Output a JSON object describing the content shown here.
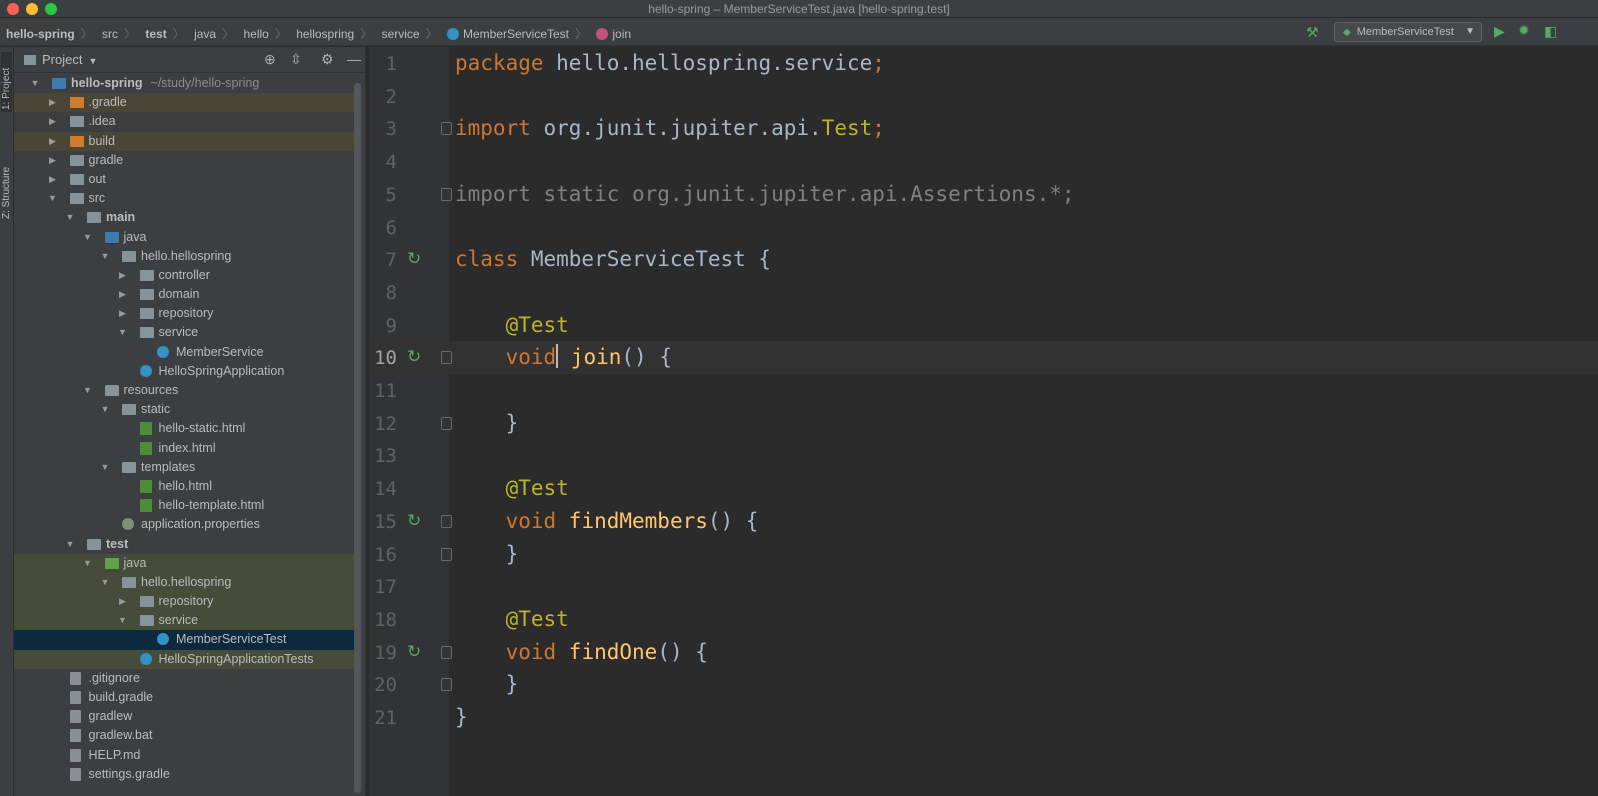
{
  "window": {
    "title": "hello-spring – MemberServiceTest.java [hello-spring.test]"
  },
  "navbar": {
    "crumbs": [
      "hello-spring",
      "src",
      "test",
      "java",
      "hello",
      "hellospring",
      "service",
      "MemberServiceTest",
      "join"
    ],
    "run_config": "MemberServiceTest"
  },
  "toolwindows": {
    "project_tab": "1: Project",
    "structure_tab": "Z: Structure"
  },
  "project_panel": {
    "title": "Project",
    "tree": [
      {
        "label": "hello-spring",
        "path": "~/study/hello-spring",
        "depth": 0,
        "expanded": true,
        "icon": "module-folder",
        "bold": true
      },
      {
        "label": ".gradle",
        "depth": 1,
        "expanded": false,
        "icon": "excluded-folder",
        "row": "excluded"
      },
      {
        "label": ".idea",
        "depth": 1,
        "expanded": false,
        "icon": "folder"
      },
      {
        "label": "build",
        "depth": 1,
        "expanded": false,
        "icon": "excluded-folder",
        "row": "excluded"
      },
      {
        "label": "gradle",
        "depth": 1,
        "expanded": false,
        "icon": "folder"
      },
      {
        "label": "out",
        "depth": 1,
        "expanded": false,
        "icon": "folder"
      },
      {
        "label": "src",
        "depth": 1,
        "expanded": true,
        "icon": "folder"
      },
      {
        "label": "main",
        "depth": 2,
        "expanded": true,
        "icon": "folder",
        "bold": true
      },
      {
        "label": "java",
        "depth": 3,
        "expanded": true,
        "icon": "source-folder"
      },
      {
        "label": "hello.hellospring",
        "depth": 4,
        "expanded": true,
        "icon": "package"
      },
      {
        "label": "controller",
        "depth": 5,
        "expanded": false,
        "icon": "package"
      },
      {
        "label": "domain",
        "depth": 5,
        "expanded": false,
        "icon": "package"
      },
      {
        "label": "repository",
        "depth": 5,
        "expanded": false,
        "icon": "package"
      },
      {
        "label": "service",
        "depth": 5,
        "expanded": true,
        "icon": "package"
      },
      {
        "label": "MemberService",
        "depth": 6,
        "icon": "class"
      },
      {
        "label": "HelloSpringApplication",
        "depth": 5,
        "icon": "class"
      },
      {
        "label": "resources",
        "depth": 3,
        "expanded": true,
        "icon": "resources-folder"
      },
      {
        "label": "static",
        "depth": 4,
        "expanded": true,
        "icon": "folder"
      },
      {
        "label": "hello-static.html",
        "depth": 5,
        "icon": "html"
      },
      {
        "label": "index.html",
        "depth": 5,
        "icon": "html"
      },
      {
        "label": "templates",
        "depth": 4,
        "expanded": true,
        "icon": "folder"
      },
      {
        "label": "hello.html",
        "depth": 5,
        "icon": "html"
      },
      {
        "label": "hello-template.html",
        "depth": 5,
        "icon": "html"
      },
      {
        "label": "application.properties",
        "depth": 4,
        "icon": "properties"
      },
      {
        "label": "test",
        "depth": 2,
        "expanded": true,
        "icon": "folder",
        "bold": true
      },
      {
        "label": "java",
        "depth": 3,
        "expanded": true,
        "icon": "test-folder",
        "row": "test"
      },
      {
        "label": "hello.hellospring",
        "depth": 4,
        "expanded": true,
        "icon": "package",
        "row": "test"
      },
      {
        "label": "repository",
        "depth": 5,
        "expanded": false,
        "icon": "package",
        "row": "test"
      },
      {
        "label": "service",
        "depth": 5,
        "expanded": true,
        "icon": "package",
        "row": "test"
      },
      {
        "label": "MemberServiceTest",
        "depth": 6,
        "icon": "class",
        "row": "selected"
      },
      {
        "label": "HelloSpringApplicationTests",
        "depth": 5,
        "icon": "class",
        "row": "test"
      },
      {
        "label": ".gitignore",
        "depth": 1,
        "icon": "file"
      },
      {
        "label": "build.gradle",
        "depth": 1,
        "icon": "file"
      },
      {
        "label": "gradlew",
        "depth": 1,
        "icon": "file"
      },
      {
        "label": "gradlew.bat",
        "depth": 1,
        "icon": "file"
      },
      {
        "label": "HELP.md",
        "depth": 1,
        "icon": "file"
      },
      {
        "label": "settings.gradle",
        "depth": 1,
        "icon": "file"
      }
    ]
  },
  "editor": {
    "current_line": 10,
    "lines": [
      {
        "n": "1",
        "tokens": [
          [
            "kw",
            "package "
          ],
          [
            "",
            "hello.hellospring.service"
          ],
          [
            "kw",
            ";"
          ]
        ]
      },
      {
        "n": "2",
        "tokens": []
      },
      {
        "n": "3",
        "fold": true,
        "tokens": [
          [
            "kw",
            "import "
          ],
          [
            "",
            "org.junit.jupiter.api."
          ],
          [
            "ann",
            "Test"
          ],
          [
            "kw",
            ";"
          ]
        ]
      },
      {
        "n": "4",
        "tokens": []
      },
      {
        "n": "5",
        "fold": true,
        "tokens": [
          [
            "dim",
            "import static org.junit.jupiter.api.Assertions.*;"
          ]
        ]
      },
      {
        "n": "6",
        "tokens": []
      },
      {
        "n": "7",
        "run": true,
        "tokens": [
          [
            "kw",
            "class "
          ],
          [
            "",
            "MemberServiceTest {"
          ]
        ]
      },
      {
        "n": "8",
        "tokens": []
      },
      {
        "n": "9",
        "tokens": [
          [
            "",
            "    "
          ],
          [
            "ann",
            "@Test"
          ]
        ]
      },
      {
        "n": "10",
        "run": true,
        "fold": true,
        "tokens": [
          [
            "",
            "    "
          ],
          [
            "kw",
            "void"
          ],
          [
            "cursor",
            ""
          ],
          [
            "",
            " "
          ],
          [
            "fn",
            "join"
          ],
          [
            "",
            "() {"
          ]
        ]
      },
      {
        "n": "11",
        "tokens": []
      },
      {
        "n": "12",
        "fold": true,
        "tokens": [
          [
            "",
            "    }"
          ]
        ]
      },
      {
        "n": "13",
        "tokens": []
      },
      {
        "n": "14",
        "tokens": [
          [
            "",
            "    "
          ],
          [
            "ann",
            "@Test"
          ]
        ]
      },
      {
        "n": "15",
        "run": true,
        "fold": true,
        "tokens": [
          [
            "",
            "    "
          ],
          [
            "kw",
            "void "
          ],
          [
            "fn",
            "findMembers"
          ],
          [
            "",
            "() {"
          ]
        ]
      },
      {
        "n": "16",
        "fold": true,
        "tokens": [
          [
            "",
            "    }"
          ]
        ]
      },
      {
        "n": "17",
        "tokens": []
      },
      {
        "n": "18",
        "tokens": [
          [
            "",
            "    "
          ],
          [
            "ann",
            "@Test"
          ]
        ]
      },
      {
        "n": "19",
        "run": true,
        "fold": true,
        "tokens": [
          [
            "",
            "    "
          ],
          [
            "kw",
            "void "
          ],
          [
            "fn",
            "findOne"
          ],
          [
            "",
            "() {"
          ]
        ]
      },
      {
        "n": "20",
        "fold": true,
        "tokens": [
          [
            "",
            "    }"
          ]
        ]
      },
      {
        "n": "21",
        "tokens": [
          [
            "",
            "}"
          ]
        ]
      }
    ]
  }
}
